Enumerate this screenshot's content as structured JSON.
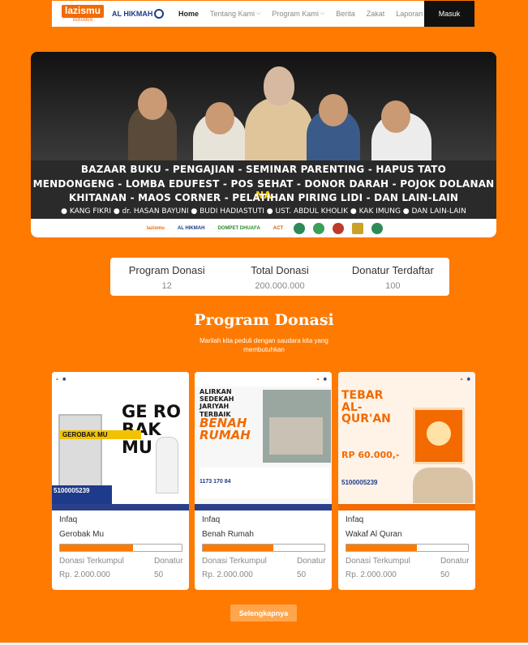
{
  "nav": {
    "logo_lazis": "lazismu",
    "logo_lazis_sub": "KEBUMEN",
    "logo_alhikmah": "AL HIKMAH",
    "items": [
      {
        "label": "Home",
        "dropdown": false,
        "active": true
      },
      {
        "label": "Tentang Kami",
        "dropdown": true,
        "active": false
      },
      {
        "label": "Program Kami",
        "dropdown": true,
        "active": false
      },
      {
        "label": "Berita",
        "dropdown": true,
        "active": false
      },
      {
        "label": "Zakat",
        "dropdown": false,
        "active": false
      },
      {
        "label": "Laporan",
        "dropdown": false,
        "active": false
      }
    ],
    "login_label": "Masuk"
  },
  "banner": {
    "line1": "BAZAAR BUKU - PENGAJIAN - SEMINAR PARENTING - HAPUS TATO",
    "line2_main": "MENDONGENG - LOMBA EDUFEST - POS SEHAT - DONOR DARAH - POJOK DOLANAN",
    "line2_highlight": "NA",
    "line3": "KHITANAN - MAOS CORNER - PELATIHAN PIRING LIDI - DAN LAIN-LAIN",
    "names": "● KANG FIKRI  ● dr. HASAN BAYUNI  ● BUDI HADIASTUTI  ● UST. ABDUL KHOLIK  ● KAK IMUNG  ● DAN LAIN-LAIN",
    "sponsors": [
      "lazismu",
      "AL HIKMAH",
      "DOMPET DHUAFA",
      "ACT",
      "",
      "",
      "",
      "",
      ""
    ]
  },
  "stats": [
    {
      "label": "Program Donasi",
      "value": "12"
    },
    {
      "label": "Total Donasi",
      "value": "200.000.000"
    },
    {
      "label": "Donatur Terdaftar",
      "value": "100"
    }
  ],
  "section": {
    "title": "Program Donasi",
    "subtitle": "Marilah kita peduli dengan saudara kita yang membutuhkan"
  },
  "cards": [
    {
      "category": "Infaq",
      "title": "Gerobak Mu",
      "progress": 0.6,
      "collected_label": "Donasi Terkumpul",
      "collected_value": "Rp. 2.000.000",
      "donors_label": "Donatur",
      "donors_value": "50",
      "img_headline": "GE RO BAK MU",
      "img_sign": "GEROBAK MU",
      "img_rek": "5100005239"
    },
    {
      "category": "Infaq",
      "title": "Benah Rumah",
      "progress": 0.58,
      "collected_label": "Donasi Terkumpul",
      "collected_value": "Rp. 2.000.000",
      "donors_label": "Donatur",
      "donors_value": "50",
      "img_headline": "ALIRKAN SEDEKAH JARIYAH TERBAIK",
      "img_title": "BENAH RUMAH",
      "img_rek": "1173 170 84"
    },
    {
      "category": "Infaq",
      "title": "Wakaf Al Quran",
      "progress": 0.58,
      "collected_label": "Donasi Terkumpul",
      "collected_value": "Rp. 2.000.000",
      "donors_label": "Donatur",
      "donors_value": "50",
      "img_headline": "TEBAR AL-QUR'AN",
      "img_price": "RP 60.000,-",
      "img_rek": "5100005239"
    }
  ],
  "more_button": "Selengkapnya",
  "colors": {
    "accent": "#ff7a00",
    "dark": "#111111",
    "banner_highlight": "#ffd400"
  }
}
